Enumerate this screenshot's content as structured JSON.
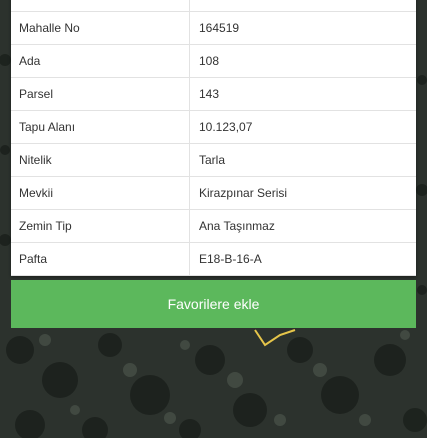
{
  "map": {
    "background_color": "#2a302b",
    "parcel_outline_color": "#e6c54a"
  },
  "parcel_table": {
    "rows": [
      {
        "label": "",
        "value": ""
      },
      {
        "label": "Mahalle No",
        "value": "164519"
      },
      {
        "label": "Ada",
        "value": "108"
      },
      {
        "label": "Parsel",
        "value": "143"
      },
      {
        "label": "Tapu Alanı",
        "value": "10.123,07"
      },
      {
        "label": "Nitelik",
        "value": "Tarla"
      },
      {
        "label": "Mevkii",
        "value": "Kirazpınar Serisi"
      },
      {
        "label": "Zemin Tip",
        "value": "Ana Taşınmaz"
      },
      {
        "label": "Pafta",
        "value": "E18-B-16-A"
      }
    ]
  },
  "actions": {
    "favorite_label": "Favorilere ekle",
    "favorite_color": "#5cb85c"
  }
}
